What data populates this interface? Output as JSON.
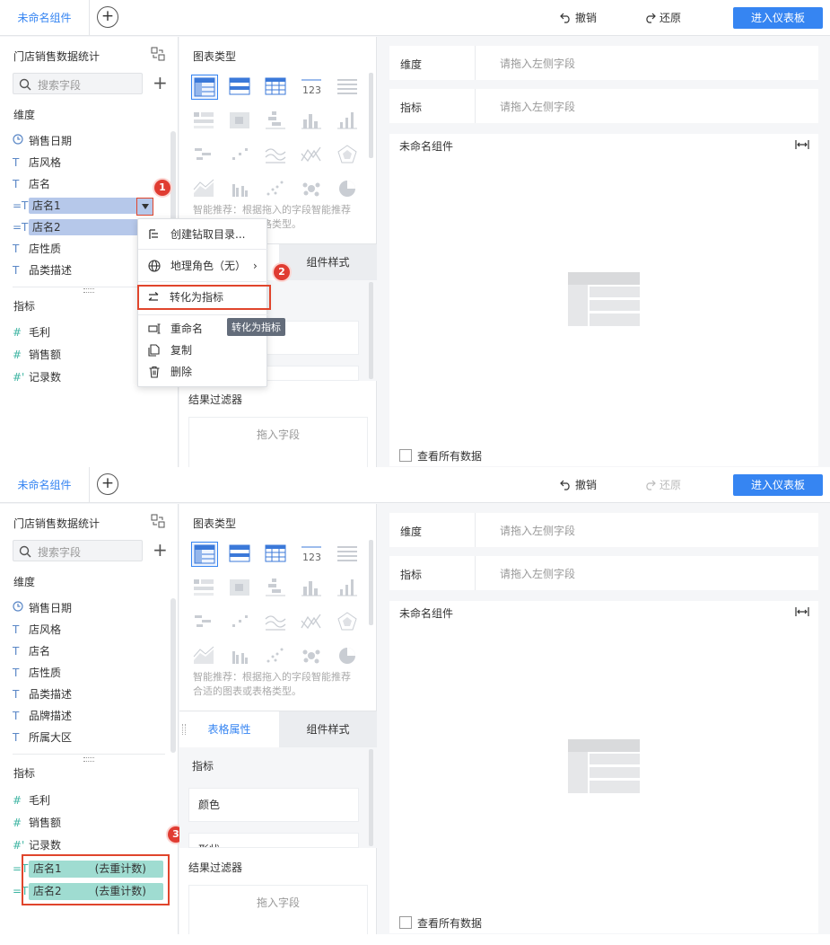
{
  "top": {
    "tab_name": "未命名组件",
    "undo": "撤销",
    "redo": "还原",
    "enter_dashboard": "进入仪表板"
  },
  "left": {
    "dataset_title": "门店销售数据统计",
    "search_placeholder": "搜索字段",
    "dimension_title": "维度",
    "measure_title": "指标"
  },
  "s1": {
    "dimensions": [
      {
        "icon": "clock",
        "label": "销售日期"
      },
      {
        "icon": "T",
        "label": "店风格"
      },
      {
        "icon": "T",
        "label": "店名"
      },
      {
        "icon": "=T",
        "label": "店名1",
        "selected": true
      },
      {
        "icon": "=T",
        "label": "店名2",
        "selected": true
      },
      {
        "icon": "T",
        "label": "店性质"
      },
      {
        "icon": "T",
        "label": "品类描述"
      }
    ],
    "measures": [
      {
        "icon": "#",
        "label": "毛利"
      },
      {
        "icon": "#",
        "label": "销售额"
      },
      {
        "icon": "#'",
        "label": "记录数"
      }
    ],
    "menu": {
      "drill": "创建钻取目录...",
      "geo_role": "地理角色（无）",
      "convert": "转化为指标",
      "rename": "重命名",
      "copy": "复制",
      "delete": "删除"
    },
    "tooltip": "转化为指标",
    "badges": [
      "1",
      "2"
    ],
    "panel": {
      "result_filter": "结果过滤器",
      "drag_field": "拖入字段"
    }
  },
  "s2": {
    "dimensions": [
      {
        "icon": "clock",
        "label": "销售日期"
      },
      {
        "icon": "T",
        "label": "店风格"
      },
      {
        "icon": "T",
        "label": "店名"
      },
      {
        "icon": "T",
        "label": "店性质"
      },
      {
        "icon": "T",
        "label": "品类描述"
      },
      {
        "icon": "T",
        "label": "品牌描述"
      },
      {
        "icon": "T",
        "label": "所属大区"
      }
    ],
    "measures": [
      {
        "icon": "#",
        "label": "毛利"
      },
      {
        "icon": "#",
        "label": "销售额"
      },
      {
        "icon": "#'",
        "label": "记录数"
      }
    ],
    "converted": [
      {
        "label": "店名1",
        "suffix": "(去重计数)"
      },
      {
        "label": "店名2",
        "suffix": "(去重计数)"
      }
    ],
    "badge": "3",
    "panel": {
      "result_filter": "结果过滤器",
      "drag_field": "拖入字段"
    }
  },
  "mid": {
    "chart_type_title": "图表类型",
    "recommend": "智能推荐：根据拖入的字段智能推荐合适的图表或表格类型。",
    "tab_table_props": "表格属性",
    "tab_component_style": "组件样式",
    "measure_label": "指标",
    "color_label": "颜色",
    "shape_label": "形状"
  },
  "right": {
    "dimension_label": "维度",
    "measure_label": "指标",
    "drop_placeholder": "请拖入左侧字段",
    "component_title": "未命名组件",
    "view_all": "查看所有数据"
  },
  "colors": {
    "accent": "#3685f2",
    "highlight": "#e0452c",
    "selected_pill": "#b6c8ea",
    "measure_pill": "#9fdcd1"
  }
}
